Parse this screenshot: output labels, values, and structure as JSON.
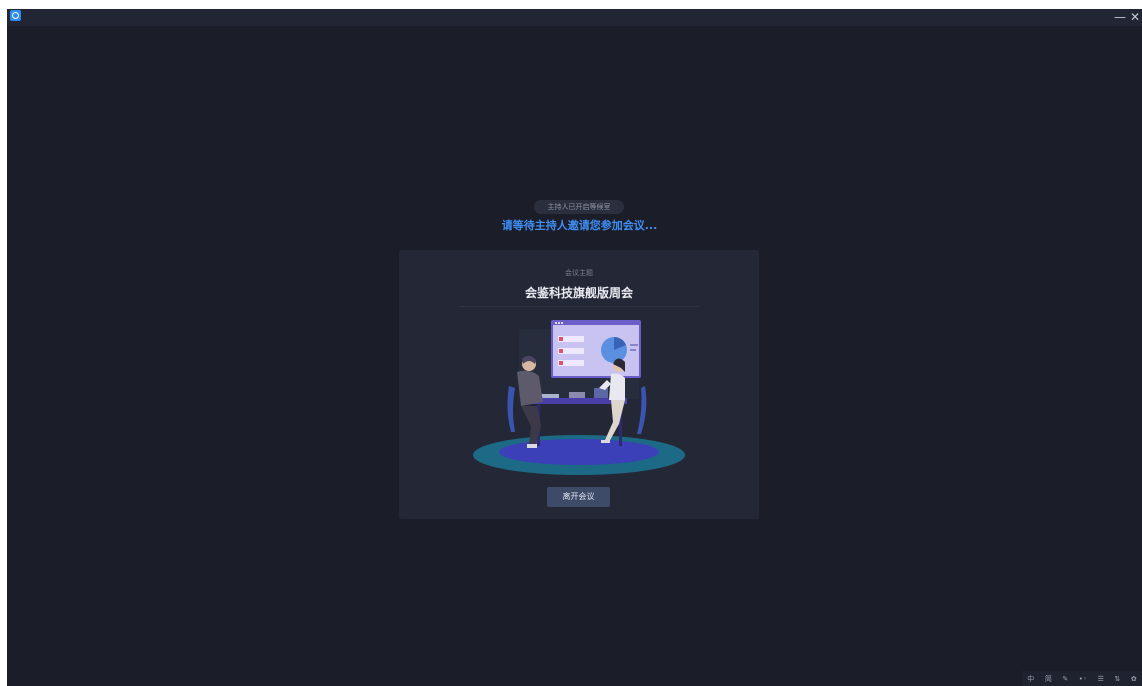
{
  "titlebar": {
    "minimize_glyph": "—",
    "close_glyph": "✕"
  },
  "waiting": {
    "status_pill": "主持人已开启等候室",
    "message": "请等待主持人邀请您参加会议..."
  },
  "meeting": {
    "topic_label": "会议主题",
    "topic_title": "会鉴科技旗舰版周会"
  },
  "actions": {
    "leave_label": "离开会议"
  },
  "ime_toolbar": {
    "items": [
      "中",
      "简",
      "✎",
      "•◦",
      "☰",
      "⇅",
      "✿"
    ]
  },
  "colors": {
    "background": "#1b1e29",
    "card": "#242836",
    "accent_text": "#3e8ef5",
    "button": "#3d4a68",
    "stage": "#3b3fb8",
    "stage_ring": "#1d6a86"
  }
}
